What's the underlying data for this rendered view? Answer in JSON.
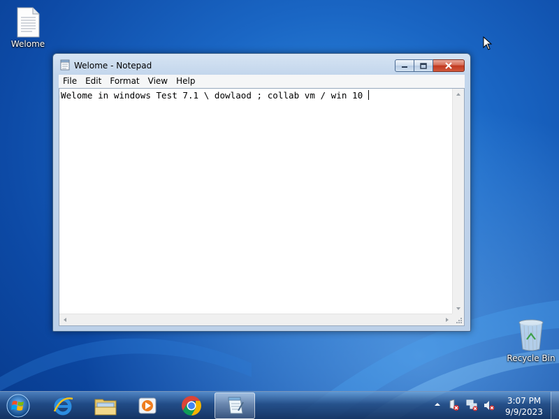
{
  "desktop": {
    "icons": [
      {
        "label": "Welome",
        "icon": "text-file-icon"
      },
      {
        "label": "Recycle Bin",
        "icon": "recycle-bin-icon"
      }
    ]
  },
  "window": {
    "title": "Welome - Notepad",
    "menu": [
      "File",
      "Edit",
      "Format",
      "View",
      "Help"
    ],
    "content": "Welome in windows Test 7.1 \\ dowlaod ; collab vm / win 10 "
  },
  "taskbar": {
    "pinned": [
      {
        "name": "internet-explorer-icon"
      },
      {
        "name": "file-explorer-icon"
      },
      {
        "name": "media-player-icon"
      },
      {
        "name": "chrome-icon"
      },
      {
        "name": "notepad-icon",
        "active": true
      }
    ],
    "tray": [
      "show-hidden-icons",
      "action-center-icon",
      "network-icon",
      "volume-muted-icon"
    ],
    "clock": {
      "time": "3:07 PM",
      "date": "9/9/2023"
    }
  },
  "colors": {
    "desktop": "#1a66c4",
    "close_button": "#c0381f",
    "title_bar": "#c3d6ec"
  }
}
